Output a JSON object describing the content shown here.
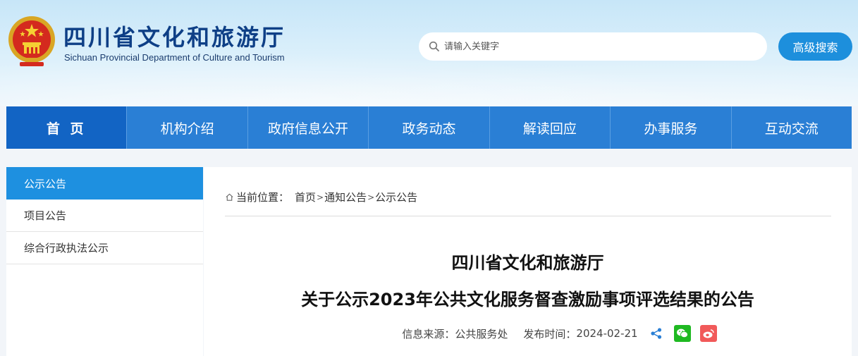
{
  "header": {
    "title": "四川省文化和旅游厅",
    "subtitle": "Sichuan Provincial Department of Culture and Tourism",
    "search_placeholder": "请输入关键字",
    "advanced_search_label": "高级搜索"
  },
  "nav": {
    "items": [
      {
        "label": "首 页",
        "active": true
      },
      {
        "label": "机构介绍"
      },
      {
        "label": "政府信息公开"
      },
      {
        "label": "政务动态"
      },
      {
        "label": "解读回应"
      },
      {
        "label": "办事服务"
      },
      {
        "label": "互动交流"
      }
    ]
  },
  "sidebar": {
    "items": [
      {
        "label": "公示公告",
        "active": true
      },
      {
        "label": "项目公告"
      },
      {
        "label": "综合行政执法公示"
      }
    ]
  },
  "breadcrumb": {
    "prefix": "当前位置：",
    "links": [
      "首页",
      "通知公告",
      "公示公告"
    ],
    "separator": ">"
  },
  "article": {
    "title_line1": "四川省文化和旅游厅",
    "title_line2": "关于公示2023年公共文化服务督查激励事项评选结果的公告",
    "source_label": "信息来源：",
    "source_value": "公共服务处",
    "date_label": "发布时间：",
    "date_value": "2024-02-21"
  },
  "colors": {
    "nav_bg": "#2a7fd5",
    "nav_active": "#1264c4",
    "accent": "#1d8fdc",
    "title_blue": "#0e3f86"
  },
  "icons": {
    "emblem": "national-emblem-icon",
    "search": "search-icon",
    "home": "home-icon",
    "share": "share-icon",
    "wechat": "wechat-icon",
    "weibo": "weibo-icon"
  }
}
